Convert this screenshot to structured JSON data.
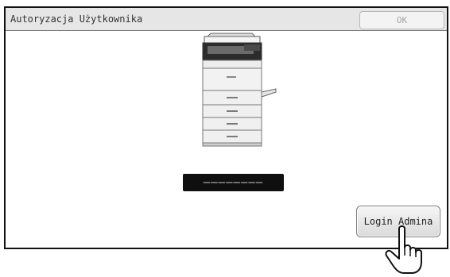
{
  "window": {
    "title": "Autoryzacja Użytkownika",
    "ok_label": "OK"
  },
  "password": {
    "masked_value": "––––––––"
  },
  "buttons": {
    "admin_login_label": "Login Admina"
  },
  "icons": {
    "device": "multifunction-printer-icon",
    "pointer": "pointing-hand-icon"
  },
  "colors": {
    "header_background": "#e6e6e6",
    "field_background": "#0f0f0f",
    "disabled_text": "#a6a6a6"
  }
}
